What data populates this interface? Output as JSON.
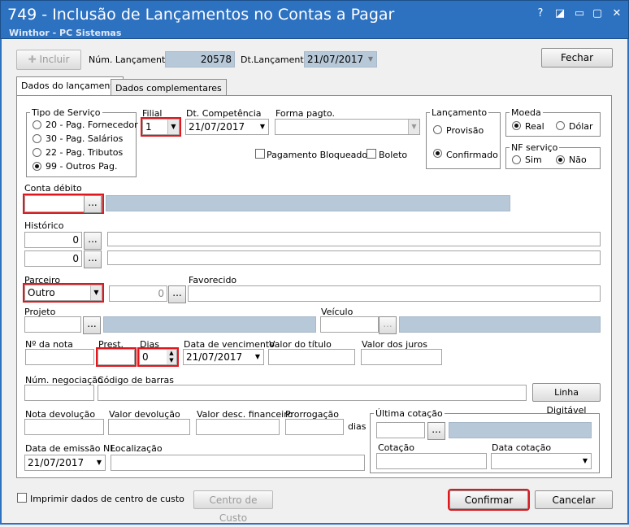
{
  "window": {
    "title": "749 - Inclusão de Lançamentos no Contas a Pagar",
    "subtitle": "Winthor - PC Sistemas",
    "controls": [
      "?",
      "◪",
      "▭",
      "▢",
      "✕"
    ]
  },
  "toolbar": {
    "incluir_label": "Incluir",
    "num_lancamento_label": "Núm. Lançamento",
    "num_lancamento_value": "20578",
    "dt_lancamento_label": "Dt.Lançamento",
    "dt_lancamento_value": "21/07/2017",
    "fechar_label": "Fechar"
  },
  "tabs": [
    {
      "label": "Dados do lançamento"
    },
    {
      "label": "Dados complementares"
    }
  ],
  "tipo_servico": {
    "label": "Tipo de Serviço",
    "options": [
      {
        "label": "20 - Pag. Fornecedor",
        "selected": false
      },
      {
        "label": "30 - Pag. Salários",
        "selected": false
      },
      {
        "label": "22 - Pag. Tributos",
        "selected": false
      },
      {
        "label": "99 - Outros Pag.",
        "selected": true
      }
    ]
  },
  "filial": {
    "label": "Filial",
    "value": "1"
  },
  "dt_competencia": {
    "label": "Dt. Competência",
    "value": "21/07/2017"
  },
  "forma_pagto": {
    "label": "Forma pagto.",
    "value": ""
  },
  "pagamento_bloqueado_label": "Pagamento Bloqueado",
  "boleto_label": "Boleto",
  "lancamento": {
    "label": "Lançamento",
    "options": [
      {
        "label": "Provisão",
        "selected": false
      },
      {
        "label": "Confirmado",
        "selected": true
      }
    ]
  },
  "moeda": {
    "label": "Moeda",
    "options": [
      {
        "label": "Real",
        "selected": true
      },
      {
        "label": "Dólar",
        "selected": false
      }
    ]
  },
  "nf_servico": {
    "label": "NF serviço",
    "options": [
      {
        "label": "Sim",
        "selected": false
      },
      {
        "label": "Não",
        "selected": true
      }
    ]
  },
  "conta_debito": {
    "label": "Conta débito",
    "value": "",
    "ellipsis": "..."
  },
  "historico": {
    "label": "Histórico",
    "rows": [
      {
        "code": "0",
        "text": ""
      },
      {
        "code": "0",
        "text": ""
      }
    ]
  },
  "parceiro": {
    "label": "Parceiro",
    "value": "Outro",
    "code": "0"
  },
  "favorecido_label": "Favorecido",
  "projeto_label": "Projeto",
  "veiculo_label": "Veículo",
  "nota": {
    "numero_label": "Nº da nota",
    "prest_label": "Prest.",
    "dias_label": "Dias",
    "dias_value": "0",
    "vencimento_label": "Data de vencimento",
    "vencimento_value": "21/07/2017",
    "valor_titulo_label": "Valor do título",
    "valor_juros_label": "Valor dos juros"
  },
  "num_negociacao_label": "Núm. negociação",
  "codigo_barras_label": "Código de barras",
  "linha_digitavel_label": "Linha Digitável",
  "nota_devolucao_label": "Nota devolução",
  "valor_devolucao_label": "Valor devolução",
  "valor_desc_fin_label": "Valor desc. financeiro",
  "prorrogacao_label": "Prorrogação",
  "dias_suffix": "dias",
  "ultima_cotacao_label": "Última cotação",
  "cotacao_label": "Cotação",
  "data_cotacao_label": "Data cotação",
  "data_emissao": {
    "label": "Data de emissão NF",
    "value": "21/07/2017"
  },
  "localizacao_label": "Localização",
  "footer": {
    "imprimir_label": "Imprimir dados de centro de custo",
    "centro_custo_label": "Centro de Custo",
    "confirmar_label": "Confirmar",
    "cancelar_label": "Cancelar"
  }
}
